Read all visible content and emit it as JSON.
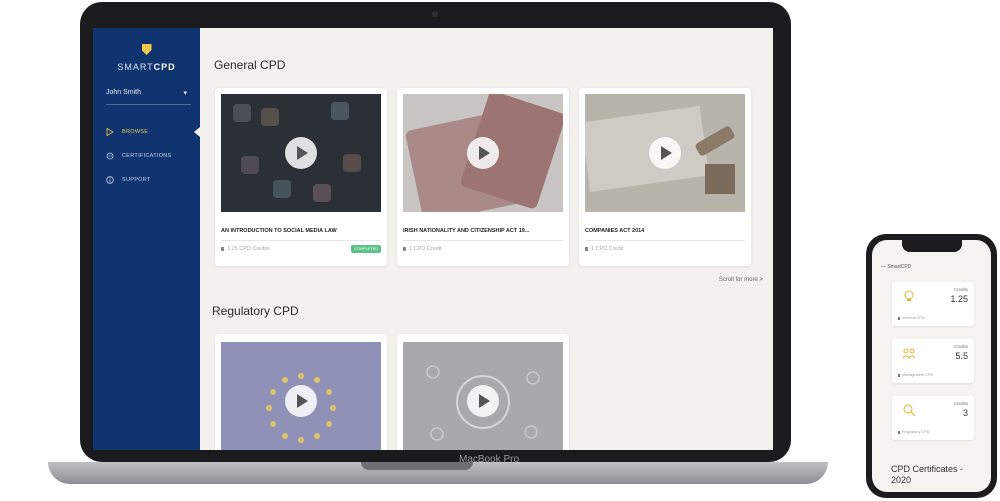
{
  "laptop": {
    "model_label": "MacBook Pro"
  },
  "sidebar": {
    "logo": {
      "part1": "SMART",
      "part2": "CPD"
    },
    "user_name": "John Smith",
    "items": [
      {
        "label": "BROWSE",
        "icon": "play-outline-icon",
        "active": true
      },
      {
        "label": "CERTIFICATIONS",
        "icon": "badge-icon",
        "active": false
      },
      {
        "label": "SUPPORT",
        "icon": "info-icon",
        "active": false
      }
    ]
  },
  "sections": [
    {
      "title": "General CPD",
      "cards": [
        {
          "title": "AN INTRODUCTION TO SOCIAL MEDIA LAW",
          "credit": "1.25 CPD Credits",
          "badge": "COMPLETED",
          "thumb_color": "#2b2f36"
        },
        {
          "title": "IRISH NATIONALITY AND CITIZENSHIP ACT 19...",
          "credit": "1 CPD Credit",
          "badge": "",
          "thumb_color": "#b0adab"
        },
        {
          "title": "COMPANIES ACT 2014",
          "credit": "1 CPD Credit",
          "badge": "",
          "thumb_color": "#a8a49c"
        }
      ],
      "scroll_more": "Scroll for more >"
    },
    {
      "title": "Regulatory CPD",
      "cards": [
        {
          "title": "",
          "credit": "",
          "badge": "",
          "thumb_color": "#8f92b6"
        },
        {
          "title": "",
          "credit": "",
          "badge": "",
          "thumb_color": "#a7a9ab"
        }
      ]
    }
  ],
  "phone": {
    "header": "SmartCPD",
    "cards": [
      {
        "label": "Credits",
        "value": "1.25",
        "category": "General CPD",
        "icon": "lightbulb-icon"
      },
      {
        "label": "Credits",
        "value": "5.5",
        "category": "Management CPD",
        "icon": "people-icon"
      },
      {
        "label": "Credits",
        "value": "3",
        "category": "Regulatory CPD",
        "icon": "magnifier-icon"
      }
    ],
    "footer": "CPD Certificates - 2020"
  },
  "colors": {
    "sidebar": "#0f3470",
    "accent": "#f2c94c",
    "badge": "#5cc28a"
  }
}
